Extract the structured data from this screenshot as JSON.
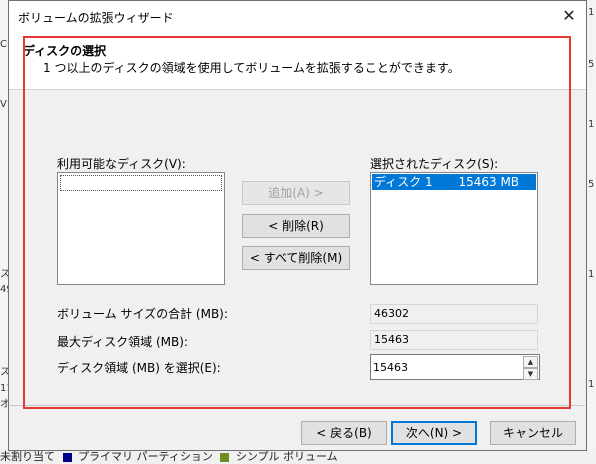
{
  "dialog": {
    "title": "ボリュームの拡張ウィザード",
    "close_glyph": "✕"
  },
  "header": {
    "title": "ディスクの選択",
    "subtitle": "1 つ以上のディスクの領域を使用してボリュームを拡張することができます。"
  },
  "available": {
    "label": "利用可能なディスク(V):"
  },
  "selected": {
    "label": "選択されたディスク(S):",
    "items": [
      {
        "disk": "ディスク 1",
        "size": "15463 MB"
      }
    ]
  },
  "buttons": {
    "add": "追加(A) >",
    "remove": "< 削除(R)",
    "remove_all": "< すべて削除(M)",
    "back": "< 戻る(B)",
    "next": "次へ(N) >",
    "cancel": "キャンセル"
  },
  "fields": {
    "total_label": "ボリューム サイズの合計 (MB):",
    "total_value": "46302",
    "max_label": "最大ディスク領域 (MB):",
    "max_value": "15463",
    "select_label": "ディスク領域 (MB) を選択(E):",
    "select_value": "15463"
  },
  "background": {
    "legend_unallocated": "未割り当て",
    "legend_primary": "プライマリ パーティション",
    "legend_simple": "シンプル ボリューム",
    "primary_color": "#00008b",
    "simple_color": "#6b8e23"
  }
}
